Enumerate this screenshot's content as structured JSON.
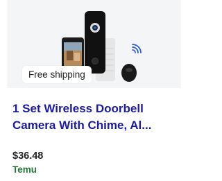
{
  "product": {
    "badge": "Free shipping",
    "title_line1": "1 Set Wireless Doorbell",
    "title_line2": "Camera With Chime, Al...",
    "price": "$36.48",
    "seller": "Temu"
  },
  "colors": {
    "title": "#1a1aa6",
    "seller": "#1e7a35",
    "price": "#202124",
    "image_bg": "#f4f5f7"
  },
  "icons": [
    "doorbell-image",
    "phone-image",
    "chime-image",
    "wifi-signal-icon"
  ]
}
